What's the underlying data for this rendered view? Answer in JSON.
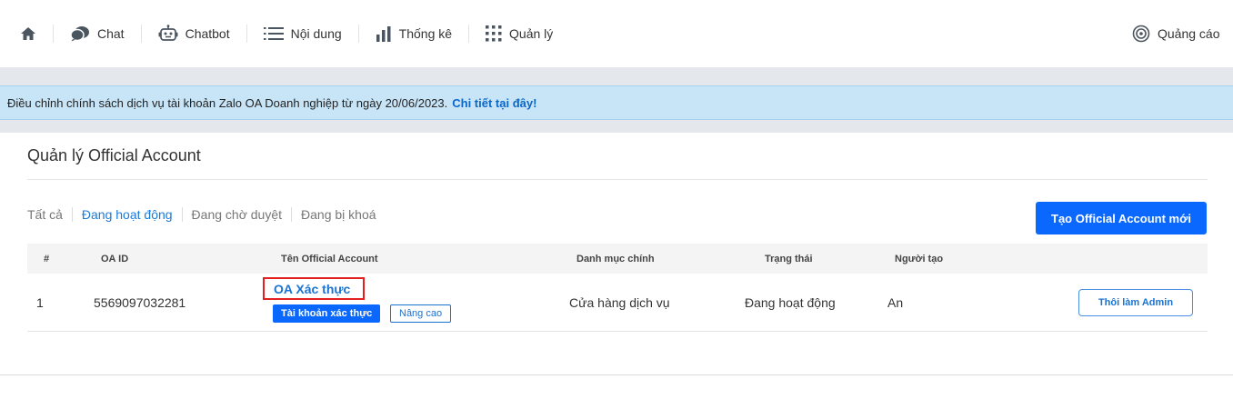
{
  "nav": {
    "home_icon": "home-icon",
    "items": [
      {
        "label": "Chat",
        "icon": "chat-bubbles-icon"
      },
      {
        "label": "Chatbot",
        "icon": "robot-icon"
      },
      {
        "label": "Nội dung",
        "icon": "list-icon"
      },
      {
        "label": "Thống kê",
        "icon": "bar-chart-icon"
      },
      {
        "label": "Quản lý",
        "icon": "grid-dots-icon"
      }
    ],
    "ads": {
      "label": "Quảng cáo",
      "icon": "target-icon"
    }
  },
  "banner": {
    "text": "Điều chỉnh chính sách dịch vụ tài khoản Zalo OA Doanh nghiệp từ ngày 20/06/2023.",
    "link": "Chi tiết tại đây!"
  },
  "page": {
    "title": "Quản lý Official Account",
    "tabs": [
      {
        "label": "Tất cả",
        "active": false
      },
      {
        "label": "Đang hoạt động",
        "active": true
      },
      {
        "label": "Đang chờ duyệt",
        "active": false
      },
      {
        "label": "Đang bị khoá",
        "active": false
      }
    ],
    "create_button": "Tạo Official Account mới"
  },
  "table": {
    "headers": [
      "#",
      "OA ID",
      "Tên Official Account",
      "Danh mục chính",
      "Trạng thái",
      "Người tạo"
    ],
    "rows": [
      {
        "index": "1",
        "oa_id": "5569097032281",
        "name": "OA Xác thực",
        "badge_verified": "Tài khoản xác thực",
        "badge_advanced": "Nâng cao",
        "category": "Cửa hàng dịch vụ",
        "status": "Đang hoạt động",
        "creator": "An",
        "action": "Thôi làm Admin"
      }
    ]
  },
  "colors": {
    "accent": "#0a68ff",
    "link": "#1a73d1",
    "banner_bg": "#c8e5f8",
    "highlight_border": "#e31f1f"
  }
}
